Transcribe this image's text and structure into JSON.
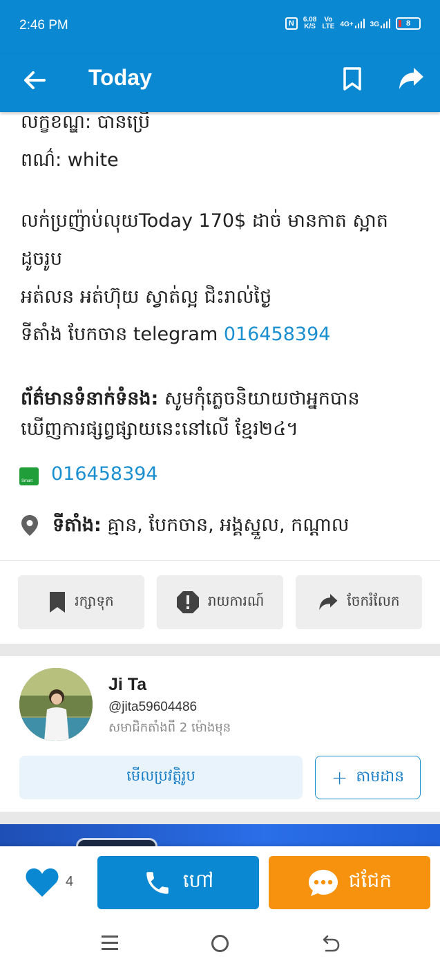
{
  "status_bar": {
    "time": "2:46 PM",
    "speed_value": "6.08",
    "speed_unit": "K/S",
    "volte_top": "Vo",
    "volte_bottom": "LTE",
    "network_1": "4G+",
    "network_2": "3G",
    "battery": "8"
  },
  "app_bar": {
    "title": "Today",
    "back_icon": "arrow-left-icon",
    "bookmark_icon": "bookmark-outline-icon",
    "share_icon": "share-icon"
  },
  "details": {
    "condition": "លក្ខខណ្ឌ: បានប្រើ",
    "color": "ពណ៌: white",
    "description_line1": "លក់ប្រញ៉ាប់លុយToday 170$ ដាច់ មានកាត ស្អាត",
    "description_line2": "ដូចរូប",
    "description_line3": "អត់លន អត់ហ៊ុយ ស្វាត់ល្អ ជិះរាល់ថ្ងៃ",
    "description_line4_prefix": "ទីតាំង បែកចាន  telegram ",
    "description_line4_phone": "016458394",
    "contact_label": "ព័ត៌មានទំនាក់ទំនង:",
    "contact_text1": " សូមកុំភ្លេចនិយាយថាអ្នកបាន",
    "contact_text2": "ឃើញការផ្សព្វផ្សាយនេះនៅលើ ខ្មែរ២៤។",
    "phone": "016458394",
    "phone_icon_label": "Smart",
    "location_label": "ទីតាំង:",
    "location_value": " គ្មាន, បែកចាន, អង្គស្នួល, កណ្ដាល"
  },
  "actions": {
    "save_label": "រក្សាទុក",
    "report_label": "រាយការណ៍",
    "share_label": "ចែករំលែក"
  },
  "seller": {
    "name": "Ji Ta",
    "handle": "@jita59604486",
    "member_since": "សមាជិកតាំងពី 2 ម៉ោងមុន",
    "view_profile_label": "មើលប្រវត្តិរូប",
    "follow_label": "តាមដាន"
  },
  "bottom_bar": {
    "like_count": "4",
    "call_label": "ហៅ",
    "chat_label": "ជជែក"
  },
  "colors": {
    "primary": "#0a88d2",
    "link": "#1a8fd0",
    "chat": "#f7920f",
    "smart_green": "#1f9e3a"
  }
}
